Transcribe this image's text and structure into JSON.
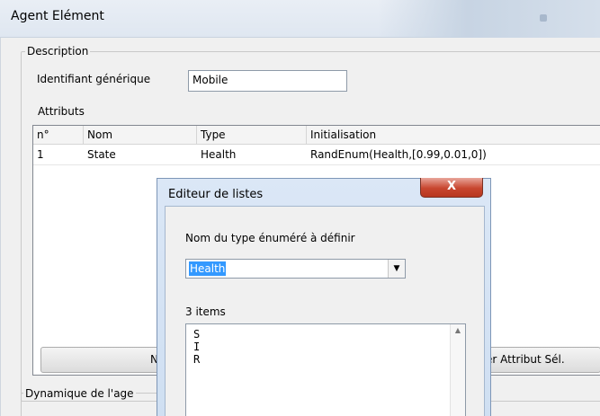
{
  "window": {
    "title": "Agent Elément"
  },
  "description": {
    "legend": "Description",
    "generic_id_label": "Identifiant générique",
    "generic_id_value": "Mobile",
    "attributes_label": "Attributs"
  },
  "attributes_table": {
    "columns": [
      "n°",
      "Nom",
      "Type",
      "Initialisation"
    ],
    "rows": [
      {
        "n": "1",
        "name": "State",
        "type": "Health",
        "init": "RandEnum(Health,[0.99,0.01,0])"
      }
    ]
  },
  "buttons": {
    "new_label": "Nouv",
    "delete_attr_label": "er Attribut Sél."
  },
  "dynamics": {
    "legend": "Dynamique de l'age"
  },
  "list_editor": {
    "title": "Editeur de listes",
    "close_glyph": "X",
    "enum_type_label": "Nom du type énuméré à définir",
    "enum_type_value": "Health",
    "items_count_label": "3 items",
    "items": [
      "S",
      "I",
      "R"
    ],
    "dropdown_glyph": "▼",
    "scroll_up_glyph": "▲"
  }
}
